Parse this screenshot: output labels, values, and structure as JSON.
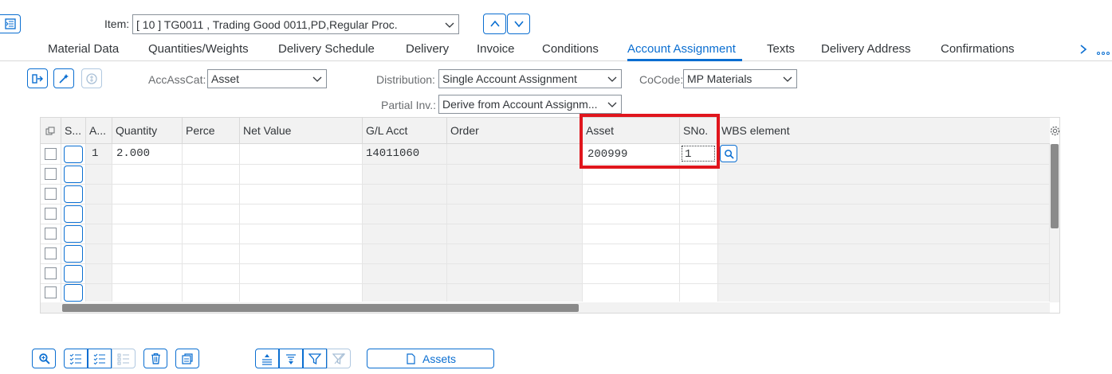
{
  "header": {
    "item_label": "Item:",
    "item_value": "[ 10 ] TG0011 , Trading Good 0011,PD,Regular Proc."
  },
  "tabs": [
    {
      "label": "Material Data"
    },
    {
      "label": "Quantities/Weights"
    },
    {
      "label": "Delivery Schedule"
    },
    {
      "label": "Delivery"
    },
    {
      "label": "Invoice"
    },
    {
      "label": "Conditions"
    },
    {
      "label": "Account Assignment",
      "active": true
    },
    {
      "label": "Texts"
    },
    {
      "label": "Delivery Address"
    },
    {
      "label": "Confirmations"
    }
  ],
  "form": {
    "accasscat_label": "AccAssCat:",
    "accasscat_value": "Asset",
    "distribution_label": "Distribution:",
    "distribution_value": "Single Account Assignment",
    "cocode_label": "CoCode:",
    "cocode_value": "MP Materials",
    "partialinv_label": "Partial Inv.:",
    "partialinv_value": "Derive from Account Assignm..."
  },
  "table": {
    "columns": [
      "S...",
      "A...",
      "Quantity",
      "Perce",
      "Net Value",
      "G/L Acct",
      "Order",
      "Asset",
      "SNo.",
      "WBS element"
    ],
    "rows": [
      {
        "a": "1",
        "quantity": "2.000",
        "gl": "14011060",
        "asset": "200999",
        "sno": "1"
      }
    ]
  },
  "footer": {
    "assets_button": "Assets"
  },
  "colors": {
    "accent": "#0a6ed1",
    "highlight": "#e0161d"
  }
}
